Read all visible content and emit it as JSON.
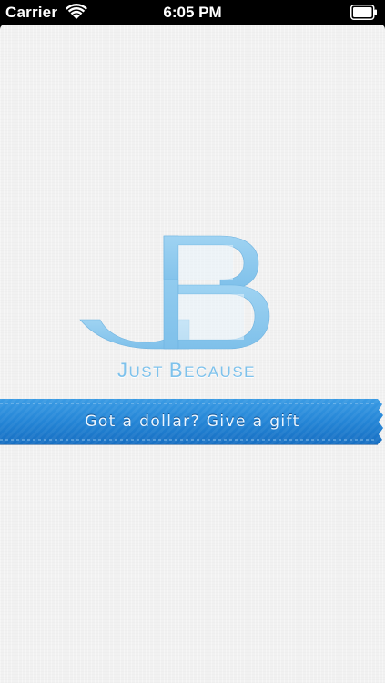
{
  "status_bar": {
    "carrier": "Carrier",
    "time": "6:05 PM",
    "wifi_icon": "wifi-icon",
    "battery_icon": "battery-icon"
  },
  "logo": {
    "monogram": "JB",
    "brand_name_first": "J",
    "brand_name_rest1": "UST ",
    "brand_name_second": "B",
    "brand_name_rest2": "ECAUSE",
    "color": "#8ecaee"
  },
  "ribbon": {
    "text": "Got a dollar? Give a gift",
    "color": "#2b8ad8",
    "color_dark": "#1e6fbd"
  }
}
